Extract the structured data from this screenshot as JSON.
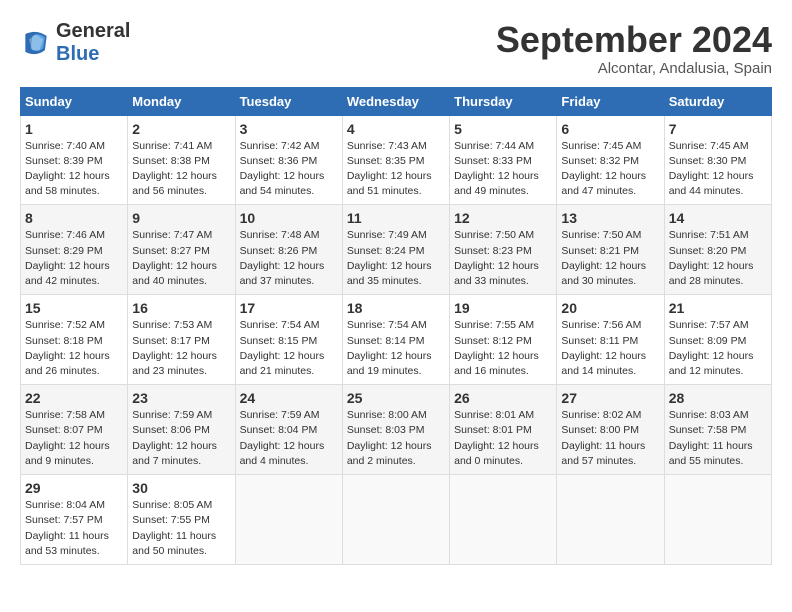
{
  "header": {
    "logo_line1": "General",
    "logo_line2": "Blue",
    "month": "September 2024",
    "location": "Alcontar, Andalusia, Spain"
  },
  "days_of_week": [
    "Sunday",
    "Monday",
    "Tuesday",
    "Wednesday",
    "Thursday",
    "Friday",
    "Saturday"
  ],
  "weeks": [
    [
      {
        "day": "1",
        "info": "Sunrise: 7:40 AM\nSunset: 8:39 PM\nDaylight: 12 hours\nand 58 minutes."
      },
      {
        "day": "2",
        "info": "Sunrise: 7:41 AM\nSunset: 8:38 PM\nDaylight: 12 hours\nand 56 minutes."
      },
      {
        "day": "3",
        "info": "Sunrise: 7:42 AM\nSunset: 8:36 PM\nDaylight: 12 hours\nand 54 minutes."
      },
      {
        "day": "4",
        "info": "Sunrise: 7:43 AM\nSunset: 8:35 PM\nDaylight: 12 hours\nand 51 minutes."
      },
      {
        "day": "5",
        "info": "Sunrise: 7:44 AM\nSunset: 8:33 PM\nDaylight: 12 hours\nand 49 minutes."
      },
      {
        "day": "6",
        "info": "Sunrise: 7:45 AM\nSunset: 8:32 PM\nDaylight: 12 hours\nand 47 minutes."
      },
      {
        "day": "7",
        "info": "Sunrise: 7:45 AM\nSunset: 8:30 PM\nDaylight: 12 hours\nand 44 minutes."
      }
    ],
    [
      {
        "day": "8",
        "info": "Sunrise: 7:46 AM\nSunset: 8:29 PM\nDaylight: 12 hours\nand 42 minutes."
      },
      {
        "day": "9",
        "info": "Sunrise: 7:47 AM\nSunset: 8:27 PM\nDaylight: 12 hours\nand 40 minutes."
      },
      {
        "day": "10",
        "info": "Sunrise: 7:48 AM\nSunset: 8:26 PM\nDaylight: 12 hours\nand 37 minutes."
      },
      {
        "day": "11",
        "info": "Sunrise: 7:49 AM\nSunset: 8:24 PM\nDaylight: 12 hours\nand 35 minutes."
      },
      {
        "day": "12",
        "info": "Sunrise: 7:50 AM\nSunset: 8:23 PM\nDaylight: 12 hours\nand 33 minutes."
      },
      {
        "day": "13",
        "info": "Sunrise: 7:50 AM\nSunset: 8:21 PM\nDaylight: 12 hours\nand 30 minutes."
      },
      {
        "day": "14",
        "info": "Sunrise: 7:51 AM\nSunset: 8:20 PM\nDaylight: 12 hours\nand 28 minutes."
      }
    ],
    [
      {
        "day": "15",
        "info": "Sunrise: 7:52 AM\nSunset: 8:18 PM\nDaylight: 12 hours\nand 26 minutes."
      },
      {
        "day": "16",
        "info": "Sunrise: 7:53 AM\nSunset: 8:17 PM\nDaylight: 12 hours\nand 23 minutes."
      },
      {
        "day": "17",
        "info": "Sunrise: 7:54 AM\nSunset: 8:15 PM\nDaylight: 12 hours\nand 21 minutes."
      },
      {
        "day": "18",
        "info": "Sunrise: 7:54 AM\nSunset: 8:14 PM\nDaylight: 12 hours\nand 19 minutes."
      },
      {
        "day": "19",
        "info": "Sunrise: 7:55 AM\nSunset: 8:12 PM\nDaylight: 12 hours\nand 16 minutes."
      },
      {
        "day": "20",
        "info": "Sunrise: 7:56 AM\nSunset: 8:11 PM\nDaylight: 12 hours\nand 14 minutes."
      },
      {
        "day": "21",
        "info": "Sunrise: 7:57 AM\nSunset: 8:09 PM\nDaylight: 12 hours\nand 12 minutes."
      }
    ],
    [
      {
        "day": "22",
        "info": "Sunrise: 7:58 AM\nSunset: 8:07 PM\nDaylight: 12 hours\nand 9 minutes."
      },
      {
        "day": "23",
        "info": "Sunrise: 7:59 AM\nSunset: 8:06 PM\nDaylight: 12 hours\nand 7 minutes."
      },
      {
        "day": "24",
        "info": "Sunrise: 7:59 AM\nSunset: 8:04 PM\nDaylight: 12 hours\nand 4 minutes."
      },
      {
        "day": "25",
        "info": "Sunrise: 8:00 AM\nSunset: 8:03 PM\nDaylight: 12 hours\nand 2 minutes."
      },
      {
        "day": "26",
        "info": "Sunrise: 8:01 AM\nSunset: 8:01 PM\nDaylight: 12 hours\nand 0 minutes."
      },
      {
        "day": "27",
        "info": "Sunrise: 8:02 AM\nSunset: 8:00 PM\nDaylight: 11 hours\nand 57 minutes."
      },
      {
        "day": "28",
        "info": "Sunrise: 8:03 AM\nSunset: 7:58 PM\nDaylight: 11 hours\nand 55 minutes."
      }
    ],
    [
      {
        "day": "29",
        "info": "Sunrise: 8:04 AM\nSunset: 7:57 PM\nDaylight: 11 hours\nand 53 minutes."
      },
      {
        "day": "30",
        "info": "Sunrise: 8:05 AM\nSunset: 7:55 PM\nDaylight: 11 hours\nand 50 minutes."
      },
      {
        "day": "",
        "info": ""
      },
      {
        "day": "",
        "info": ""
      },
      {
        "day": "",
        "info": ""
      },
      {
        "day": "",
        "info": ""
      },
      {
        "day": "",
        "info": ""
      }
    ]
  ]
}
